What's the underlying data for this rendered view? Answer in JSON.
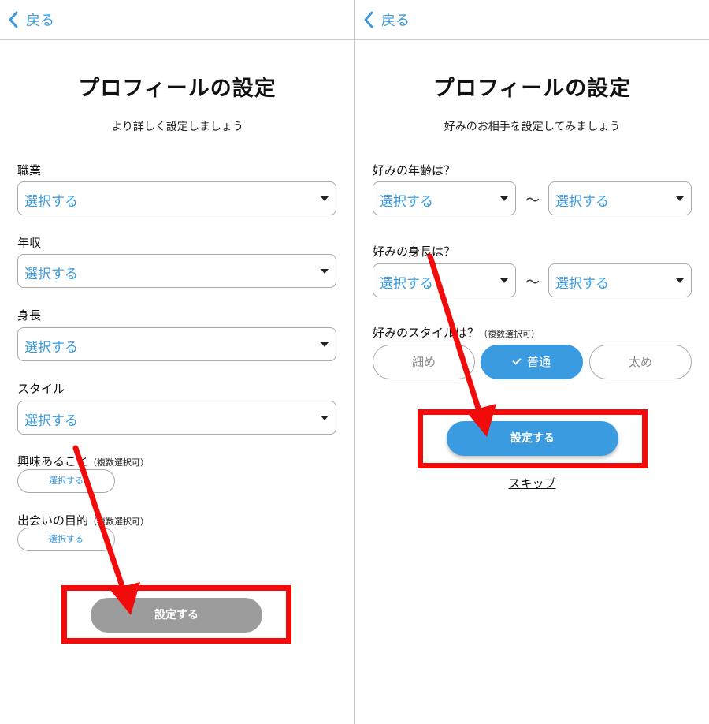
{
  "left": {
    "back_label": "戻る",
    "title": "プロフィールの設定",
    "subtitle": "より詳しく設定しましょう",
    "fields": [
      {
        "label": "職業",
        "value": "選択する"
      },
      {
        "label": "年収",
        "value": "選択する"
      },
      {
        "label": "身長",
        "value": "選択する"
      },
      {
        "label": "スタイル",
        "value": "選択する"
      }
    ],
    "interests": {
      "label": "興味あること",
      "note": "（複数選択可）",
      "button": "選択する"
    },
    "purpose": {
      "label": "出会いの目的",
      "note": "（複数選択可）",
      "button": "選択する"
    },
    "submit_label": "設定する"
  },
  "right": {
    "back_label": "戻る",
    "title": "プロフィールの設定",
    "subtitle": "好みのお相手を設定してみましょう",
    "age": {
      "label": "好みの年齢は？",
      "from": "選択する",
      "to": "選択する",
      "separator": "〜"
    },
    "height": {
      "label": "好みの身長は？",
      "from": "選択する",
      "to": "選択する",
      "separator": "〜"
    },
    "style": {
      "label": "好みのスタイルは？",
      "note": "（複数選択可）",
      "options": [
        {
          "label": "細め",
          "selected": false
        },
        {
          "label": "普通",
          "selected": true
        },
        {
          "label": "太め",
          "selected": false
        }
      ]
    },
    "submit_label": "設定する",
    "skip_label": "スキップ"
  },
  "colors": {
    "accent": "#3a9be0",
    "disabled_button": "#9c9c9c",
    "highlight": "#f20b0b"
  }
}
